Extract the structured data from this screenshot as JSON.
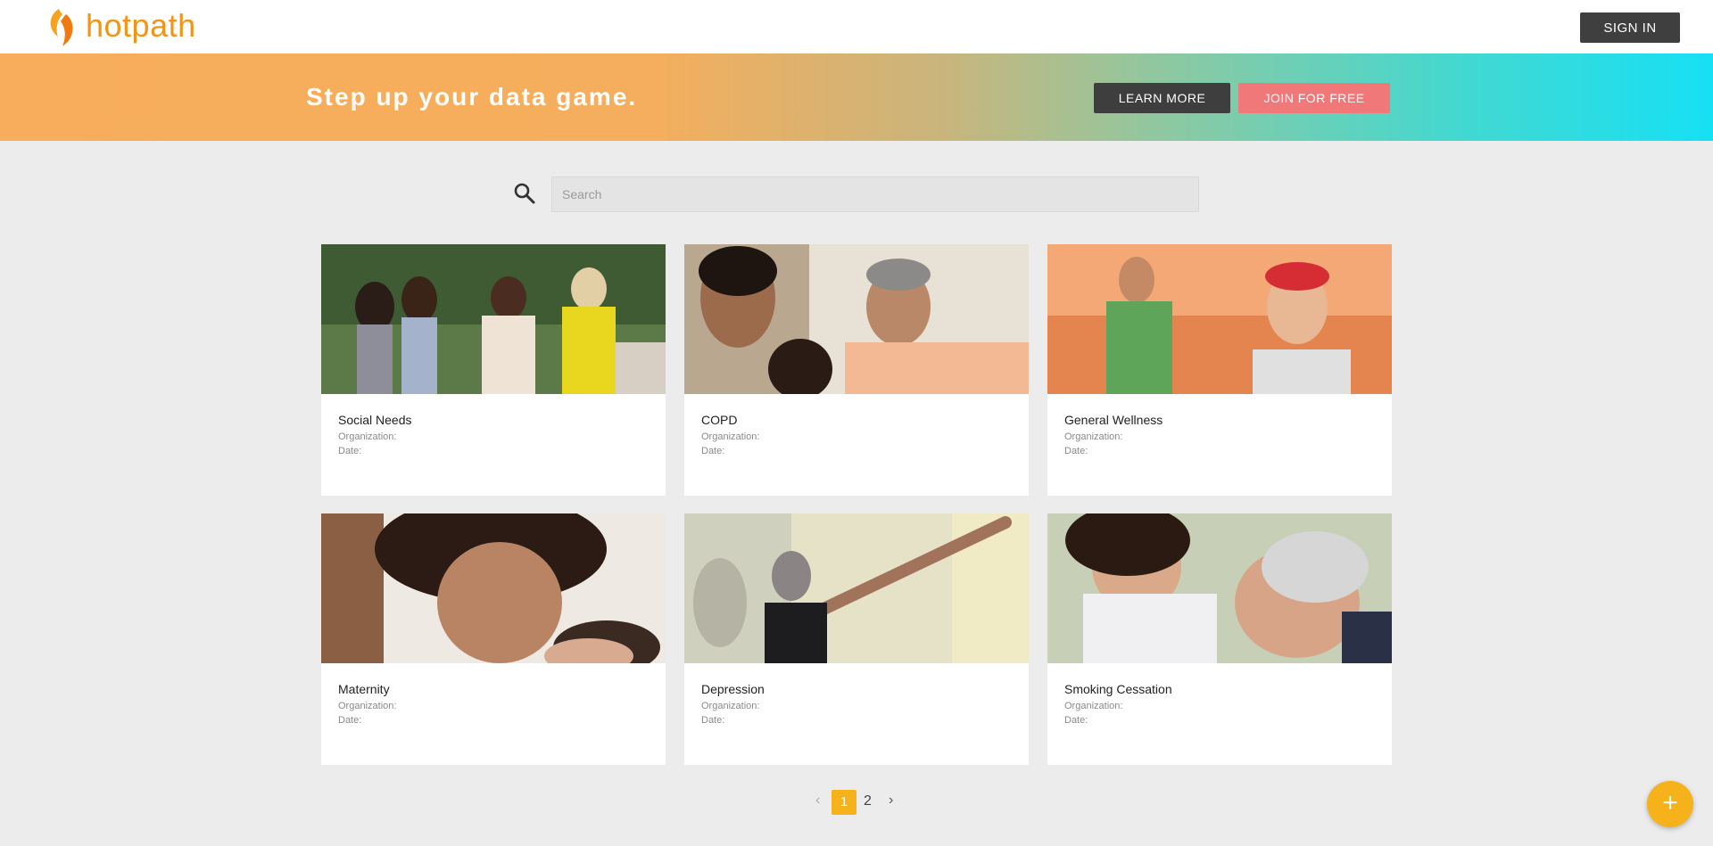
{
  "app": {
    "name": "hotpath",
    "brand_color": "#f29418",
    "accent_color": "#f6b21a"
  },
  "header": {
    "signin_label": "SIGN IN"
  },
  "banner": {
    "headline": "Step up your data game.",
    "learn_more_label": "LEARN MORE",
    "join_label": "JOIN FOR FREE"
  },
  "search": {
    "placeholder": "Search",
    "value": "",
    "icon": "search-icon"
  },
  "cards": [
    {
      "title": "Social Needs",
      "organization_label": "Organization:",
      "date_label": "Date:",
      "image": "group-of-women-walking-photo"
    },
    {
      "title": "COPD",
      "organization_label": "Organization:",
      "date_label": "Date:",
      "image": "older-man-with-family-photo"
    },
    {
      "title": "General Wellness",
      "organization_label": "Organization:",
      "date_label": "Date:",
      "image": "hikers-smiling-photo"
    },
    {
      "title": "Maternity",
      "organization_label": "Organization:",
      "date_label": "Date:",
      "image": "mother-and-baby-photo"
    },
    {
      "title": "Depression",
      "organization_label": "Organization:",
      "date_label": "Date:",
      "image": "woman-exercising-photo"
    },
    {
      "title": "Smoking Cessation",
      "organization_label": "Organization:",
      "date_label": "Date:",
      "image": "grandfather-and-child-photo"
    }
  ],
  "pagination": {
    "prev": "‹",
    "pages": [
      "1",
      "2"
    ],
    "current": "1",
    "next": "›"
  },
  "fab": {
    "label": "+"
  }
}
